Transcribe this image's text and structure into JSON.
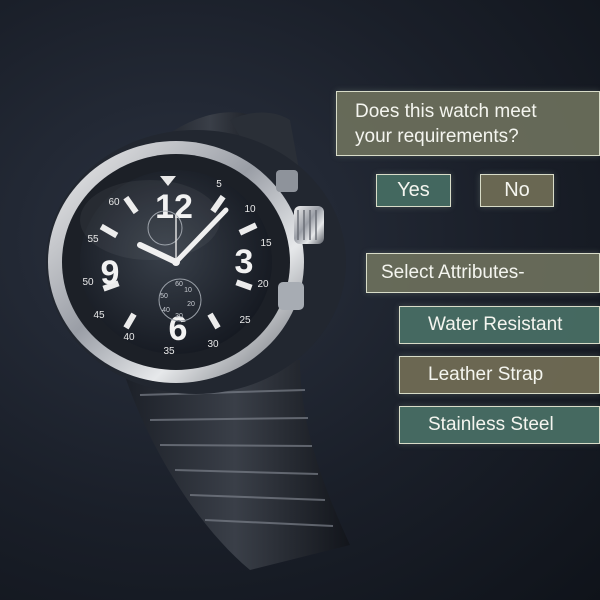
{
  "question": {
    "line1": "Does this watch meet",
    "line2": "your requirements?"
  },
  "answers": {
    "yes_label": "Yes",
    "no_label": "No"
  },
  "attributes": {
    "heading": "Select Attributes-",
    "items": [
      {
        "label": "Water Resistant"
      },
      {
        "label": "Leather Strap"
      },
      {
        "label": "Stainless Steel"
      }
    ]
  },
  "watch": {
    "dial_numerals": [
      "12",
      "3",
      "6",
      "9"
    ],
    "bezel_marks": [
      "5",
      "10",
      "15",
      "20",
      "25",
      "30",
      "35",
      "40",
      "45",
      "50",
      "55",
      "60"
    ],
    "subdial_marks": [
      "10",
      "20",
      "30",
      "40",
      "50",
      "60"
    ]
  },
  "colors": {
    "teal_button": "#466c62",
    "olive_button": "#6e6c54",
    "panel_border": "#d8dcc8"
  }
}
